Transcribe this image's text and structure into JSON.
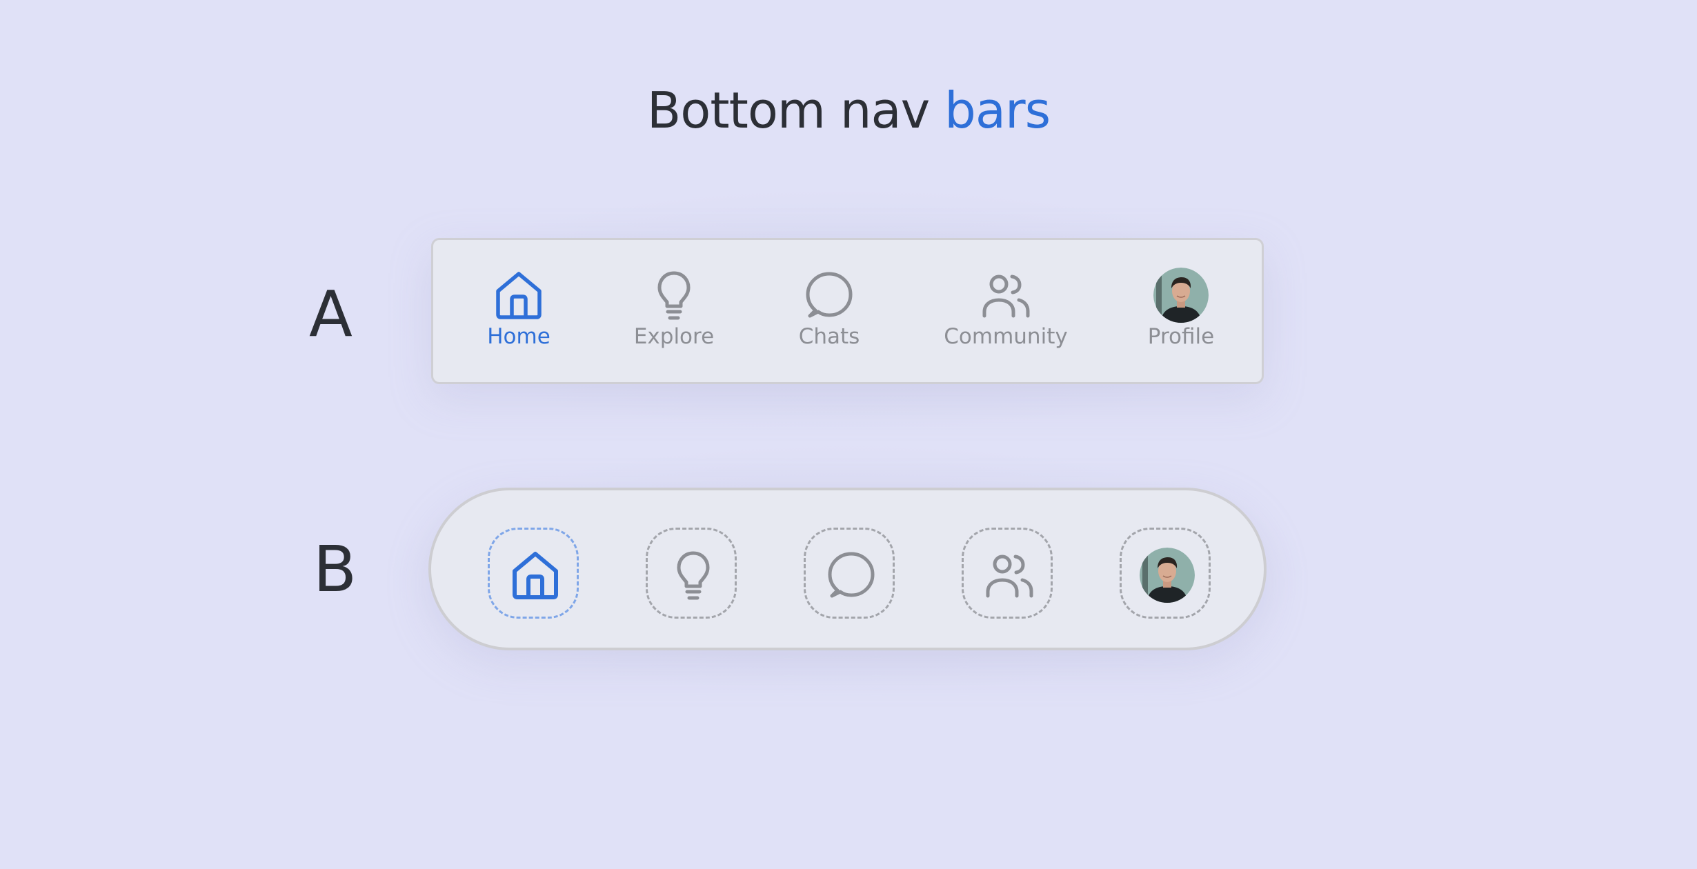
{
  "header": {
    "title_main": "Bottom nav",
    "title_accent": "bars"
  },
  "variants": {
    "a": {
      "label": "A"
    },
    "b": {
      "label": "B"
    }
  },
  "nav_items": [
    {
      "label": "Home",
      "icon": "home-icon",
      "active": true
    },
    {
      "label": "Explore",
      "icon": "lightbulb-icon",
      "active": false
    },
    {
      "label": "Chats",
      "icon": "chat-bubble-icon",
      "active": false
    },
    {
      "label": "Community",
      "icon": "users-icon",
      "active": false
    },
    {
      "label": "Profile",
      "icon": "avatar",
      "active": false
    }
  ],
  "colors": {
    "background": "#e0e1f7",
    "accent": "#2e6fd8",
    "inactive": "#8c8e94",
    "text_dark": "#2c2f36"
  }
}
